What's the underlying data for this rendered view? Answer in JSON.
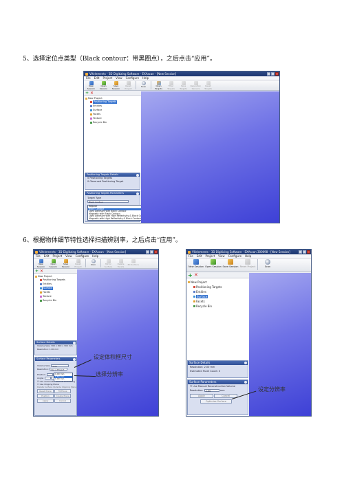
{
  "step5": {
    "caption": "5、选择定位点类型（Black contour：带黑圈点），之后点击“应用”。",
    "window": {
      "title": "VXelements - 3D Digitizing Software - EXAscan - [New Session]",
      "menu": [
        "File",
        "Edit",
        "Project",
        "View",
        "Configure",
        "Help"
      ],
      "toolbar": [
        {
          "label": "New Session",
          "icon": "new-session-icon"
        },
        {
          "label": "Open Session",
          "icon": "open-folder-icon"
        },
        {
          "label": "Save Session",
          "icon": "save-icon"
        },
        {
          "label": "Reset Project",
          "icon": "reset-icon",
          "disabled": true
        },
        {
          "label": "Scan",
          "icon": "scan-icon"
        },
        {
          "label": "Open Targets",
          "icon": "targets-icon"
        },
        {
          "label": "Filter Targets",
          "icon": "filter-icon",
          "disabled": true
        },
        {
          "label": "Save Targets",
          "icon": "save-targets-icon",
          "disabled": true
        },
        {
          "label": "Reposition Sensors",
          "icon": "reposition-icon",
          "disabled": true
        },
        {
          "label": "Reset Targets",
          "icon": "reset-targets-icon",
          "disabled": true
        }
      ],
      "tree": {
        "root": "New Project",
        "items": [
          "Positioning Targets",
          "Entities",
          "Surface",
          "Facets",
          "Texture",
          "Recycle Bin"
        ],
        "selected": "Positioning Targets"
      },
      "targets_panel": {
        "title": "Positioning Targets Details",
        "lines": [
          "0 Positioning Targets",
          "0 Observed Positioning Target"
        ]
      },
      "params_panel": {
        "title": "Positioning Targets Parameters",
        "target_type_label": "Target Type",
        "target_type_value": "Black Contour",
        "options": [
          "Regular",
          "Black Contour",
          "Light Adhesive with Black Contour",
          "Magnetic with Black Contour",
          "Light Adhesive with High Reflectivity & Black Contour",
          "Magnetic with High Reflectivity & Black Contour"
        ],
        "highlighted_option": "Black Contour"
      }
    }
  },
  "step6": {
    "caption": "6、根据物体细节特性选择扫描辨别率，之后点击“应用”。",
    "left_window": {
      "title": "VXelements - 3D Digitizing Software - EXAscan - [New Session]",
      "menu": [
        "File",
        "Edit",
        "Project",
        "View",
        "Configure",
        "Help"
      ],
      "toolbar": [
        {
          "label": "New Session",
          "icon": "new-session-icon"
        },
        {
          "label": "Open Session",
          "icon": "open-folder-icon"
        },
        {
          "label": "Save Session",
          "icon": "save-icon"
        },
        {
          "label": "Reset Project",
          "icon": "reset-icon",
          "disabled": true
        },
        {
          "label": "Scan",
          "icon": "scan-icon"
        },
        {
          "label": "Mirror Surface",
          "icon": "mirror-icon",
          "disabled": true
        },
        {
          "label": "Delete Facets",
          "icon": "delete-facets-icon",
          "disabled": true
        },
        {
          "label": "3D Surface",
          "icon": "surface-3d-icon",
          "disabled": true
        }
      ],
      "tree": {
        "root": "New Project",
        "items": [
          "Positioning Targets",
          "Entities",
          "Surface",
          "Facets",
          "Texture",
          "Recycle Bin"
        ],
        "selected": "Surface"
      },
      "details_panel": {
        "title": "Surface Details",
        "lines": [
          "Volume Size: 300 x 300 x 300 mm",
          "Resolution: 1.00 mm"
        ]
      },
      "params_panel": {
        "title": "Surface Parameters",
        "volume_size_label": "Volume Size:",
        "volume_size_value": "Auto",
        "resolution_label": "Resolution:",
        "resolution_value": "Use a Project",
        "resolution_options": [
          "1.00 mm",
          "0.50 mm",
          "1.00 mm"
        ],
        "position_label": "Position:",
        "angle_label": "Angle:",
        "checkboxes": [
          "Use Automatic Volume Positioning",
          "Use Clipping Plane",
          "Delete Surface Outside Clipping Plane"
        ],
        "buttons": [
          "Reset Plane",
          "Fit/Plane",
          "Position",
          "Create Plane",
          "Apply",
          "Cancel"
        ]
      },
      "annotations": [
        "设定体积框尺寸",
        "选择分辨率"
      ]
    },
    "right_window": {
      "title": "VXelements - 3D Digitizing Software - EXAscan 300098 - [New Session]",
      "menu": [
        "File",
        "Edit",
        "Project",
        "View",
        "Configure",
        "Help"
      ],
      "toolbar": [
        {
          "label": "New Session",
          "icon": "new-session-icon"
        },
        {
          "label": "Open Session",
          "icon": "open-folder-icon"
        },
        {
          "label": "Save Session",
          "icon": "save-icon"
        },
        {
          "label": "Reset Project",
          "icon": "reset-icon",
          "disabled": true
        },
        {
          "label": "Scan",
          "icon": "scan-icon"
        }
      ],
      "tree": {
        "root": "New Project",
        "items": [
          "Positioning Targets",
          "Entities",
          "Surface",
          "Facets",
          "Recycle Bin"
        ],
        "selected": "Surface"
      },
      "details_panel": {
        "title": "Surface Details",
        "lines": [
          "Resolution: 2.00 mm",
          "Estimated Facet Count: 0"
        ]
      },
      "params_panel": {
        "title": "Surface Parameters",
        "checkbox": "Use Manual Reconstruction Volume",
        "resolution_label": "Resolution:",
        "resolution_value": "2.00",
        "resolution_unit": "mm",
        "buttons": [
          "Apply",
          "Cancel",
          "Optimize Surface"
        ]
      },
      "annotation": "设定分辨率"
    }
  }
}
